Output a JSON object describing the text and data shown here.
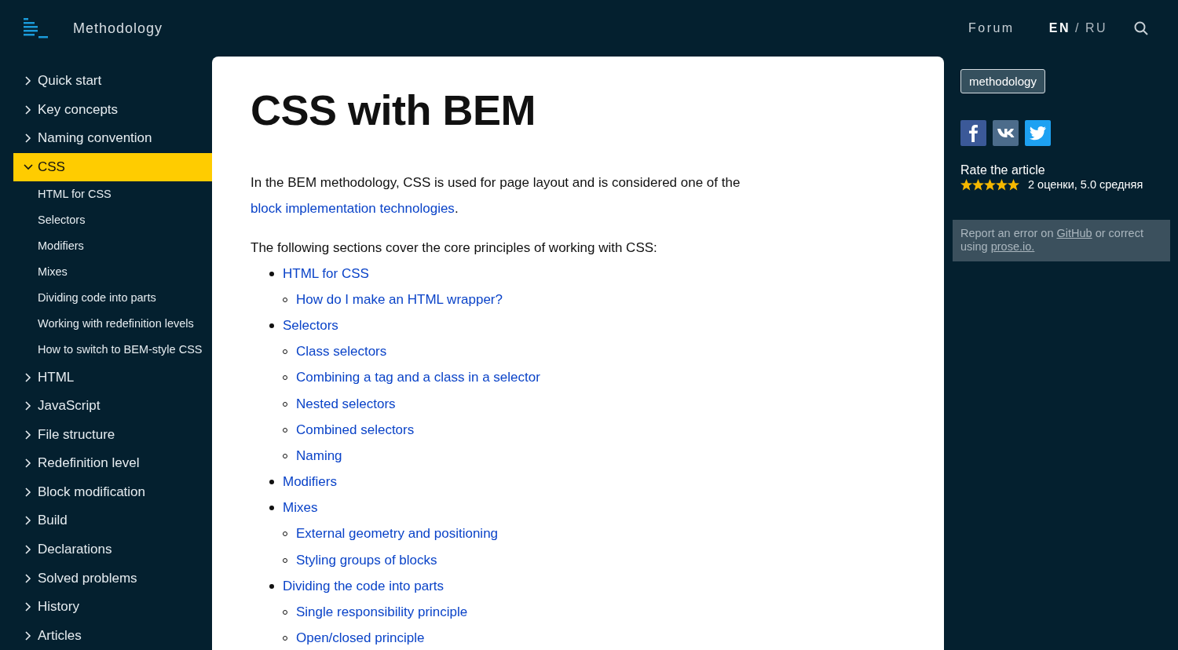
{
  "header": {
    "site_title": "Methodology",
    "nav": [
      {
        "label": "Forum"
      }
    ],
    "languages": [
      {
        "label": "EN",
        "selected": true
      },
      {
        "label": "RU",
        "selected": false
      }
    ],
    "separator": "/"
  },
  "sidebar": {
    "items": [
      {
        "label": "Quick start",
        "expanded": false,
        "selected": false
      },
      {
        "label": "Key concepts",
        "expanded": false,
        "selected": false
      },
      {
        "label": "Naming convention",
        "expanded": false,
        "selected": false
      },
      {
        "label": "CSS",
        "expanded": true,
        "selected": true,
        "children": [
          {
            "label": "HTML for CSS",
            "selected": false
          },
          {
            "label": "Selectors",
            "selected": false
          },
          {
            "label": "Modifiers",
            "selected": false
          },
          {
            "label": "Mixes",
            "selected": false
          },
          {
            "label": "Dividing code into parts",
            "selected": false
          },
          {
            "label": "Working with redefinition levels",
            "selected": false
          },
          {
            "label": "How to switch to BEM-style CSS",
            "selected": false
          }
        ]
      },
      {
        "label": "HTML",
        "expanded": false,
        "selected": false
      },
      {
        "label": "JavaScript",
        "expanded": false,
        "selected": false
      },
      {
        "label": "File structure",
        "expanded": false,
        "selected": false
      },
      {
        "label": "Redefinition level",
        "expanded": false,
        "selected": false
      },
      {
        "label": "Block modification",
        "expanded": false,
        "selected": false
      },
      {
        "label": "Build",
        "expanded": false,
        "selected": false
      },
      {
        "label": "Declarations",
        "expanded": false,
        "selected": false
      },
      {
        "label": "Solved problems",
        "expanded": false,
        "selected": false
      },
      {
        "label": "History",
        "expanded": false,
        "selected": false
      },
      {
        "label": "Articles",
        "expanded": false,
        "selected": false
      }
    ]
  },
  "article": {
    "title": "CSS with BEM",
    "intro": [
      {
        "kind": "text",
        "text": "In the BEM methodology, CSS is used for page layout and is considered one of the "
      },
      {
        "kind": "link",
        "text": "block implementation technologies"
      },
      {
        "kind": "text",
        "text": "."
      }
    ],
    "lead": "The following sections cover the core principles of working with CSS:",
    "toc": [
      {
        "label": "HTML for CSS",
        "children": [
          {
            "label": "How do I make an HTML wrapper?"
          }
        ]
      },
      {
        "label": "Selectors",
        "children": [
          {
            "label": "Class selectors"
          },
          {
            "label": "Combining a tag and a class in a selector"
          },
          {
            "label": "Nested selectors"
          },
          {
            "label": "Combined selectors"
          },
          {
            "label": "Naming"
          }
        ]
      },
      {
        "label": "Modifiers"
      },
      {
        "label": "Mixes",
        "children": [
          {
            "label": "External geometry and positioning"
          },
          {
            "label": "Styling groups of blocks"
          }
        ]
      },
      {
        "label": "Dividing the code into parts",
        "children": [
          {
            "label": "Single responsibility principle"
          },
          {
            "label": "Open/closed principle"
          }
        ]
      }
    ]
  },
  "aside": {
    "tag": "methodology",
    "social": [
      {
        "kind": "facebook"
      },
      {
        "kind": "vk"
      },
      {
        "kind": "twitter"
      }
    ],
    "rating": {
      "title": "Rate the article",
      "stars": 5,
      "summary": "2 оценки, 5.0 средняя"
    },
    "report": [
      {
        "kind": "text",
        "text": "Report an error on "
      },
      {
        "kind": "link",
        "text": "GitHub"
      },
      {
        "kind": "text",
        "text": " or correct using "
      },
      {
        "kind": "link",
        "text": "prose.io."
      }
    ]
  }
}
